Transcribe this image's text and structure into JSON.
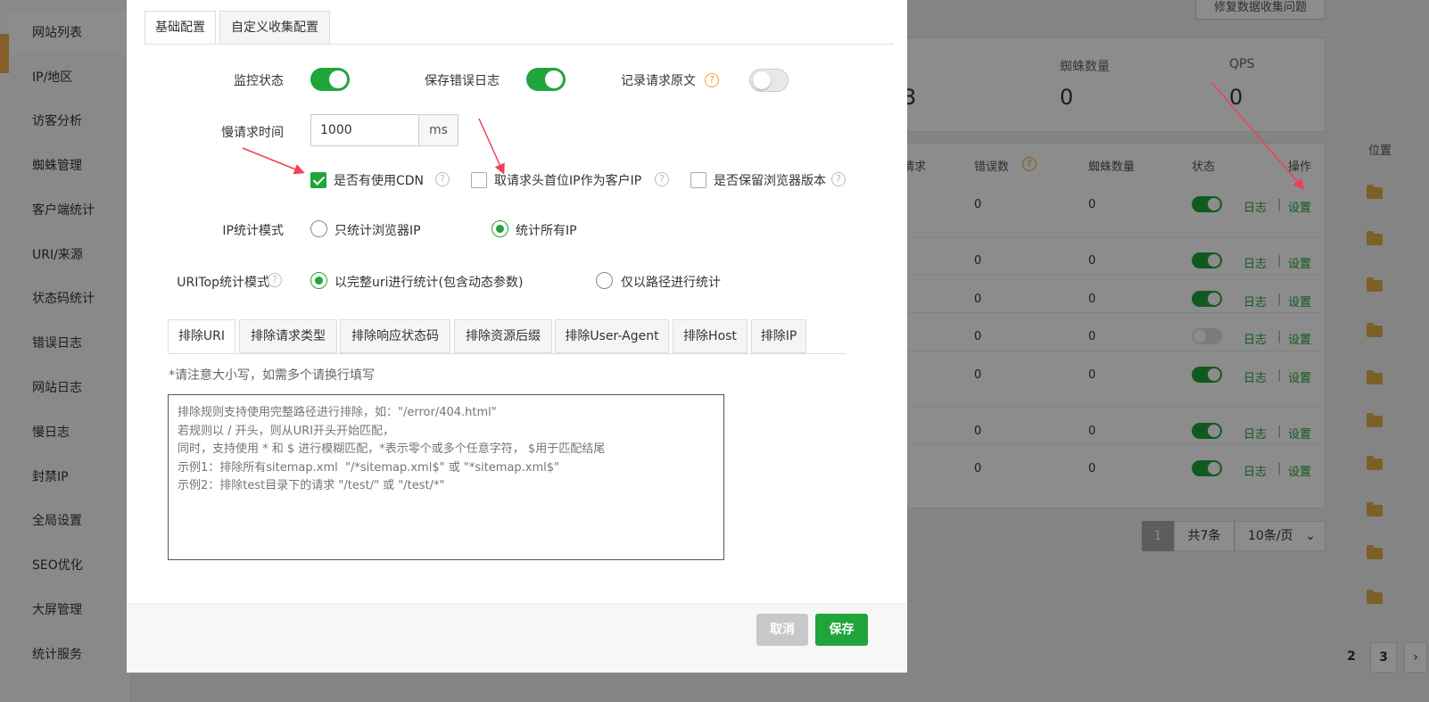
{
  "sidebar": {
    "items": [
      "网站列表",
      "IP/地区",
      "访客分析",
      "蜘蛛管理",
      "客户端统计",
      "URI/来源",
      "状态码统计",
      "错误日志",
      "网站日志",
      "慢日志",
      "封禁IP",
      "全局设置",
      "SEO优化",
      "大屏管理",
      "统计服务"
    ]
  },
  "background": {
    "top_button": "修复数据收集问题",
    "stats": [
      {
        "label": "蜘蛛数量",
        "value": "0"
      },
      {
        "label": "QPS",
        "value": "0"
      }
    ],
    "partial_stat_value": "3",
    "partial_stat_label": "",
    "table_headers": [
      "请求",
      "错误数",
      "蜘蛛数量",
      "状态",
      "操作"
    ],
    "side_header": "位置",
    "rows": [
      {
        "errors": "0",
        "spiders": "0",
        "on": true
      },
      {
        "errors": "0",
        "spiders": "0",
        "on": true
      },
      {
        "errors": "0",
        "spiders": "0",
        "on": true
      },
      {
        "errors": "0",
        "spiders": "0",
        "on": false
      },
      {
        "errors": "0",
        "spiders": "0",
        "on": true
      },
      {
        "errors": "0",
        "spiders": "0",
        "on": true
      },
      {
        "errors": "0",
        "spiders": "0",
        "on": true
      }
    ],
    "log_link": "日志",
    "settings_link": "设置",
    "link_sep": "|",
    "pagination": {
      "current": "1",
      "total": "共7条",
      "per_page": "10条/页"
    },
    "bottom_pages": [
      "2",
      "3"
    ],
    "next_icon": "chevron-right-icon",
    "bottom_note": ""
  },
  "modal": {
    "tabs": [
      "基础配置",
      "自定义收集配置"
    ],
    "monitor_label": "监控状态",
    "monitor_on": true,
    "save_error_label": "保存错误日志",
    "save_error_on": true,
    "record_raw_label": "记录请求原文",
    "record_raw_on": false,
    "help_glyph": "?",
    "slow_label": "慢请求时间",
    "slow_value": "1000",
    "slow_unit": "ms",
    "cdn_label": "是否有使用CDN",
    "cdn_checked": true,
    "first_ip_label": "取请求头首位IP作为客户IP",
    "first_ip_checked": false,
    "keep_browser_label": "是否保留浏览器版本",
    "keep_browser_checked": false,
    "ip_mode_label": "IP统计模式",
    "ip_mode_options": [
      "只统计浏览器IP",
      "统计所有IP"
    ],
    "ip_mode_selected": 1,
    "uri_mode_label": "URITop统计模式",
    "uri_mode_options": [
      "以完整uri进行统计(包含动态参数)",
      "仅以路径进行统计"
    ],
    "uri_mode_selected": 0,
    "exclude_tabs": [
      "排除URI",
      "排除请求类型",
      "排除响应状态码",
      "排除资源后缀",
      "排除User-Agent",
      "排除Host",
      "排除IP"
    ],
    "hint": "*请注意大小写，如需多个请换行填写",
    "textarea_placeholder": "排除规则支持使用完整路径进行排除，如：\"/error/404.html\"\n若规则以 / 开头，则从URI开头开始匹配，\n同时，支持使用 * 和 $ 进行模糊匹配，*表示零个或多个任意字符， $用于匹配结尾\n示例1：排除所有sitemap.xml  \"/*sitemap.xml$\" 或 \"*sitemap.xml$\"\n示例2：排除test目录下的请求 \"/test/\" 或 \"/test/*\"",
    "cancel": "取消",
    "save": "保存"
  },
  "colors": {
    "accent": "#20a53a",
    "annotation_arrow": "#f0405a",
    "folder": "#e4b04a",
    "help_orange": "#f0a030"
  }
}
